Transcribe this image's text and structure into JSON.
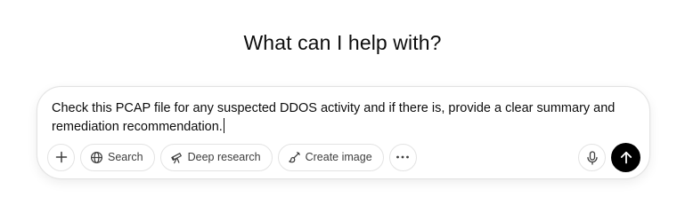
{
  "heading": "What can I help with?",
  "composer": {
    "prompt_text": "Check this PCAP file for any suspected DDOS activity and if there is, provide a clear summary and remediation recommendation."
  },
  "toolbar": {
    "attach_icon": "plus-icon",
    "search_label": "Search",
    "search_icon": "globe-icon",
    "deep_research_label": "Deep research",
    "deep_research_icon": "telescope-icon",
    "create_image_label": "Create image",
    "create_image_icon": "paint-brush-icon",
    "more_icon": "ellipsis-icon",
    "voice_icon": "microphone-icon",
    "send_icon": "arrow-up-icon"
  },
  "colors": {
    "send_button": "#000000",
    "border": "#e3e3e3",
    "text": "#0d0d0d"
  }
}
